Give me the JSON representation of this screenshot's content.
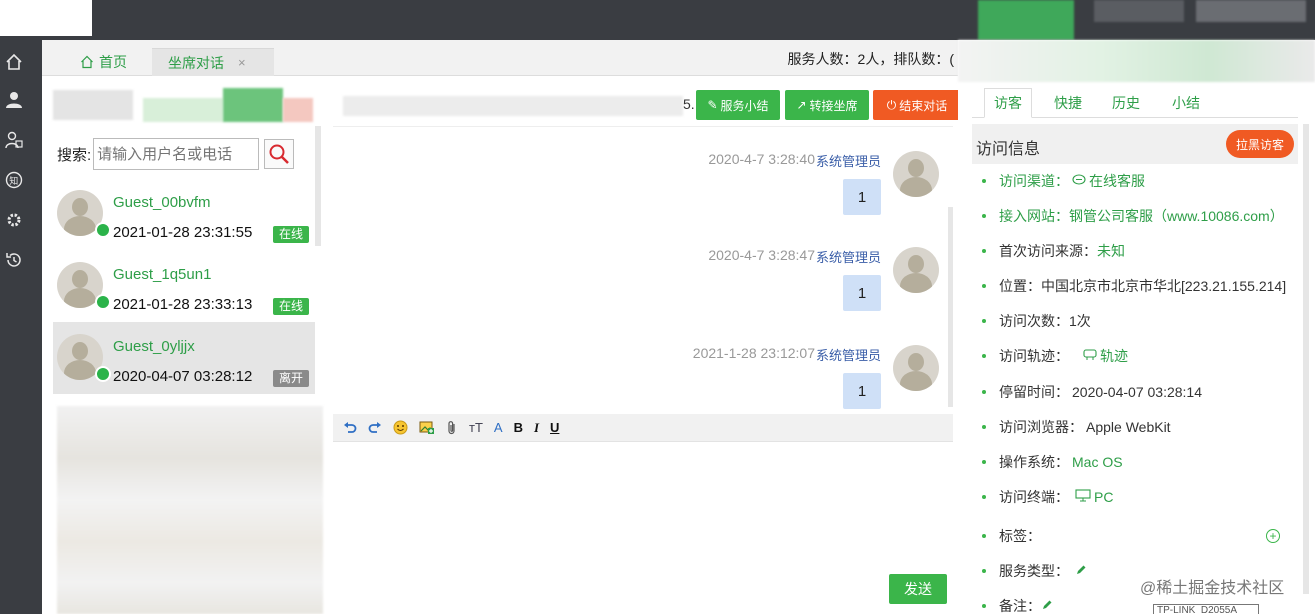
{
  "tabs": {
    "home": "首页",
    "chat": "坐席对话",
    "chat_close": "×",
    "service_count": "服务人数：2人，排队数：("
  },
  "search": {
    "label": "搜索:",
    "placeholder": "请输入用户名或电话"
  },
  "guests": [
    {
      "name": "Guest_00bvfm",
      "time": "2021-01-28 23:31:55",
      "status": "在线"
    },
    {
      "name": "Guest_1q5un1",
      "time": "2021-01-28 23:33:13",
      "status": "在线"
    },
    {
      "name": "Guest_0yljjx",
      "time": "2020-04-07 03:28:12",
      "status": "离开"
    }
  ],
  "chat": {
    "header_fragment": "5.",
    "buttons": {
      "summary": "服务小结",
      "transfer": "转接坐席",
      "end": "结束对话"
    },
    "messages": [
      {
        "time": "2020-4-7 3:28:40",
        "sender": "系统管理员",
        "text": "1"
      },
      {
        "time": "2020-4-7 3:28:47",
        "sender": "系统管理员",
        "text": "1"
      },
      {
        "time": "2021-1-28 23:12:07",
        "sender": "系统管理员",
        "text": "1"
      }
    ],
    "toolbar": {
      "font_size": "тT",
      "font_color": "A",
      "bold": "B",
      "italic": "I",
      "underline": "U"
    },
    "send": "发送"
  },
  "right_panel": {
    "tabs": [
      "访客",
      "快捷",
      "历史",
      "小结"
    ],
    "title": "访问信息",
    "blacklist": "拉黑访客",
    "info": {
      "channel_label": "访问渠道：",
      "channel_value": "在线客服",
      "site_label": "接入网站：",
      "site_value": "钢管公司客服（www.10086.com）",
      "source_label": "首次访问来源：",
      "source_value": "未知",
      "location": "位置：中国北京市北京市华北[223.21.155.214]",
      "visits": "访问次数：1次",
      "track_label": "访问轨迹：",
      "track_value": "轨迹",
      "stay_label": "停留时间：",
      "stay_value": "2020-04-07 03:28:14",
      "browser_label": "访问浏览器：",
      "browser_value": "Apple WebKit",
      "os_label": "操作系统：",
      "os_value": "Mac OS",
      "terminal_label": "访问终端：",
      "terminal_value": "PC",
      "tag_label": "标签：",
      "service_type_label": "服务类型：",
      "remark_label": "备注："
    }
  },
  "watermark": "@稀土掘金技术社区",
  "bottom_tag": "TP-LINK_D2055A"
}
